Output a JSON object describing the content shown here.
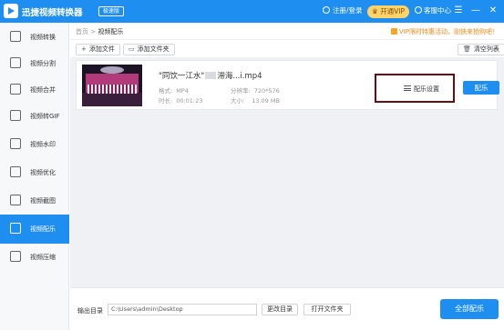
{
  "app": {
    "title": "迅捷视频转换器",
    "badge": "极速版",
    "user_link": "注册/登录",
    "vip_label": "开通VIP",
    "service_label": "客服中心",
    "menu_icon": "menu-icon",
    "minimize": "—",
    "close": "✕"
  },
  "sidebar": {
    "items": [
      {
        "label": "视频转换",
        "icon": "convert-icon"
      },
      {
        "label": "视频分割",
        "icon": "split-icon"
      },
      {
        "label": "视频合并",
        "icon": "merge-icon"
      },
      {
        "label": "视频转GIF",
        "icon": "gif-icon"
      },
      {
        "label": "视频水印",
        "icon": "watermark-icon"
      },
      {
        "label": "视频优化",
        "icon": "optimize-icon"
      },
      {
        "label": "视频截图",
        "icon": "screenshot-icon"
      },
      {
        "label": "视频配乐",
        "icon": "music-icon"
      },
      {
        "label": "视频压缩",
        "icon": "compress-icon"
      }
    ],
    "active_index": 7
  },
  "breadcrumb": {
    "home": "首页",
    "sep": ">",
    "current": "视频配乐"
  },
  "notice": "VIP限时特惠活动，刚快来抢购吧！",
  "toolbar": {
    "add_file": "添加文件",
    "add_folder": "添加文件夹",
    "clear_list": "清空列表"
  },
  "file": {
    "name_prefix": "\"同饮一江水\"",
    "name_suffix": "滞海...i.mp4",
    "format_label": "格式:",
    "format_value": "MP4",
    "resolution_label": "分辨率:",
    "resolution_value": "720*576",
    "duration_label": "时长:",
    "duration_value": "00:01:23",
    "size_label": "大小:",
    "size_value": "13.09 MB",
    "settings_label": "配乐设置",
    "action_label": "配乐"
  },
  "bottom": {
    "output_label": "输出目录",
    "output_path": "C:\\Users\\admin\\Desktop",
    "change_dir": "更改目录",
    "open_folder": "打开文件夹",
    "all_action": "全部配乐"
  },
  "colors": {
    "accent": "#1f8ef1",
    "vip": "#ffd36a",
    "highlight_border": "#6b0b14",
    "notice": "#f08c1a"
  }
}
